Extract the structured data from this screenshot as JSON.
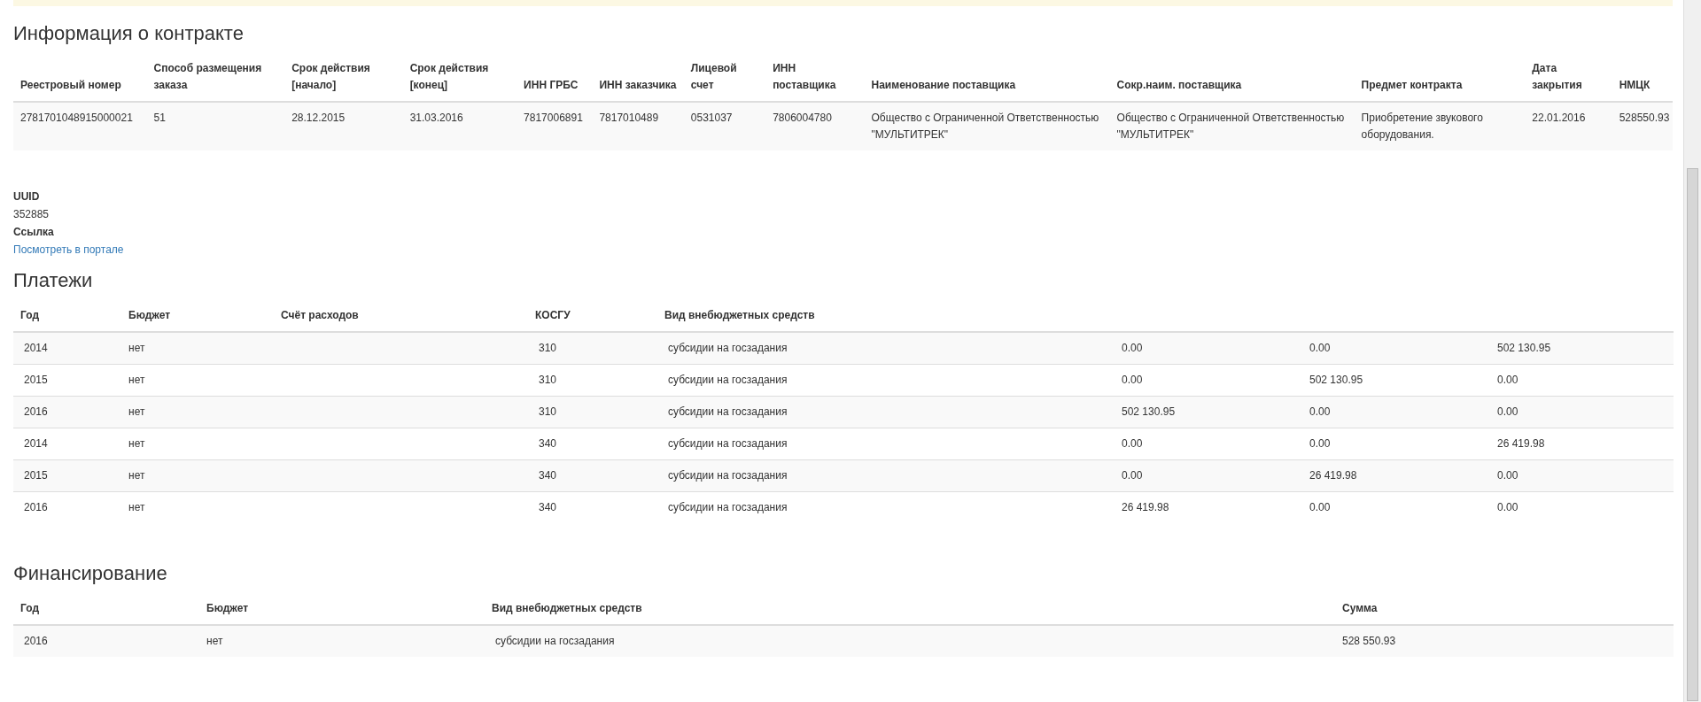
{
  "contract": {
    "title": "Информация о контракте",
    "columns": [
      "Реестровый номер",
      "Способ размещения заказа",
      "Срок действия [начало]",
      "Срок действия [конец]",
      "ИНН ГРБС",
      "ИНН заказчика",
      "Лицевой счет",
      "ИНН поставщика",
      "Наименование поставщика",
      "Сокр.наим. поставщика",
      "Предмет контракта",
      "Дата закрытия",
      "НМЦК"
    ],
    "rows": [
      [
        "2781701048915000021",
        "51",
        "28.12.2015",
        "31.03.2016",
        "7817006891",
        "7817010489",
        "0531037",
        "7806004780",
        "Общество с Ограниченной Ответственностью \"МУЛЬТИТРЕК\"",
        "Общество с Ограниченной Ответственностью \"МУЛЬТИТРЕК\"",
        "Приобретение звукового оборудования.",
        "22.01.2016",
        "528550.93"
      ]
    ]
  },
  "details": [
    {
      "label": "UUID",
      "value": "352885",
      "kind": "text"
    },
    {
      "label": "Ссылка",
      "value": "Посмотреть в портале",
      "kind": "link"
    }
  ],
  "payments": {
    "title": "Платежи",
    "columns": [
      "Год",
      "Бюджет",
      "Счёт расходов",
      "КОСГУ",
      "Вид внебюджетных средств"
    ],
    "rows": [
      {
        "year": "2014",
        "budget": "нет",
        "kosgu": "310",
        "kind": "субсидии на госзадания",
        "column_6": "0.00",
        "column_7": "0.00",
        "column_8": "502 130.95"
      },
      {
        "year": "2015",
        "budget": "нет",
        "kosgu": "310",
        "kind": "субсидии на госзадания",
        "column_6": "0.00",
        "column_7": "502 130.95",
        "column_8": "0.00"
      },
      {
        "year": "2016",
        "budget": "нет",
        "kosgu": "310",
        "kind": "субсидии на госзадания",
        "column_6": "502 130.95",
        "column_7": "0.00",
        "column_8": "0.00"
      },
      {
        "year": "2014",
        "budget": "нет",
        "kosgu": "340",
        "kind": "субсидии на госзадания",
        "column_6": "0.00",
        "column_7": "0.00",
        "column_8": "26 419.98"
      },
      {
        "year": "2015",
        "budget": "нет",
        "kosgu": "340",
        "kind": "субсидии на госзадания",
        "column_6": "0.00",
        "column_7": "26 419.98",
        "column_8": "0.00"
      },
      {
        "year": "2016",
        "budget": "нет",
        "kosgu": "340",
        "kind": "субсидии на госзадания",
        "column_6": "26 419.98",
        "column_7": "0.00",
        "column_8": "0.00"
      }
    ]
  },
  "financing": {
    "title": "Финансирование",
    "columns": [
      "Год",
      "Бюджет",
      "Вид внебюджетных средств",
      "Сумма"
    ],
    "rows": [
      [
        "2016",
        "нет",
        "субсидии на госзадания",
        "528 550.93"
      ]
    ]
  }
}
